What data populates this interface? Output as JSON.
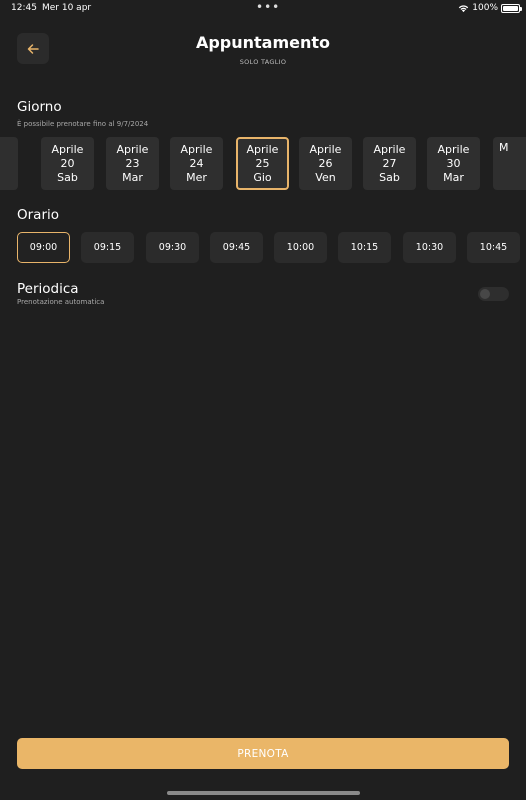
{
  "status_bar": {
    "time": "12:45",
    "date": "Mer 10 apr",
    "battery": "100%"
  },
  "header": {
    "title": "Appuntamento",
    "subtitle": "SOLO TAGLIO"
  },
  "day_section": {
    "title": "Giorno",
    "note": "È possibile prenotare fino al 9/7/2024",
    "days": [
      {
        "month": "",
        "day": "",
        "weekday": ""
      },
      {
        "month": "Aprile",
        "day": "20",
        "weekday": "Sab"
      },
      {
        "month": "Aprile",
        "day": "23",
        "weekday": "Mar"
      },
      {
        "month": "Aprile",
        "day": "24",
        "weekday": "Mer"
      },
      {
        "month": "Aprile",
        "day": "25",
        "weekday": "Gio"
      },
      {
        "month": "Aprile",
        "day": "26",
        "weekday": "Ven"
      },
      {
        "month": "Aprile",
        "day": "27",
        "weekday": "Sab"
      },
      {
        "month": "Aprile",
        "day": "30",
        "weekday": "Mar"
      },
      {
        "month": "M",
        "day": "",
        "weekday": ""
      }
    ],
    "selected_index": 4
  },
  "time_section": {
    "title": "Orario",
    "times": [
      "09:00",
      "09:15",
      "09:30",
      "09:45",
      "10:00",
      "10:15",
      "10:30",
      "10:45"
    ],
    "selected_index": 0
  },
  "recurring": {
    "title": "Periodica",
    "subtitle": "Prenotazione automatica",
    "enabled": false
  },
  "book_button": {
    "label": "PRENOTA"
  },
  "colors": {
    "accent": "#eab668",
    "background": "#1f1f1f",
    "card": "#2f2f2f"
  }
}
